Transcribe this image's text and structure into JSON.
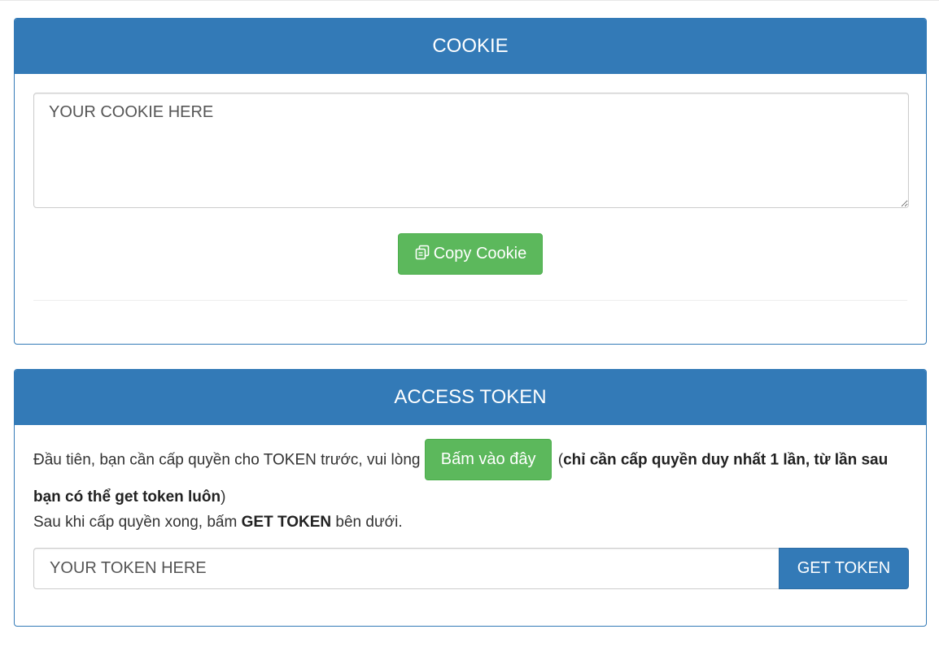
{
  "cookie_panel": {
    "title": "COOKIE",
    "textarea_placeholder": "YOUR COOKIE HERE",
    "copy_button_label": "Copy Cookie",
    "copy_icon": "copy-icon"
  },
  "token_panel": {
    "title": "ACCESS TOKEN",
    "intro_text": "Đầu tiên, bạn cần cấp quyền cho TOKEN trước, vui lòng",
    "grant_button_label": "Bấm vào đây",
    "paren_open": "(",
    "note_bold": "chỉ cần cấp quyền duy nhất 1 lần, từ lần sau bạn có thể get token luôn",
    "paren_close": ")",
    "after_prefix": "Sau khi cấp quyền xong, bấm",
    "after_bold": "GET TOKEN",
    "after_suffix": "bên dưới.",
    "input_placeholder": "YOUR TOKEN HERE",
    "get_token_label": "GET TOKEN"
  },
  "colors": {
    "primary": "#337ab7",
    "success": "#5cb85c"
  }
}
